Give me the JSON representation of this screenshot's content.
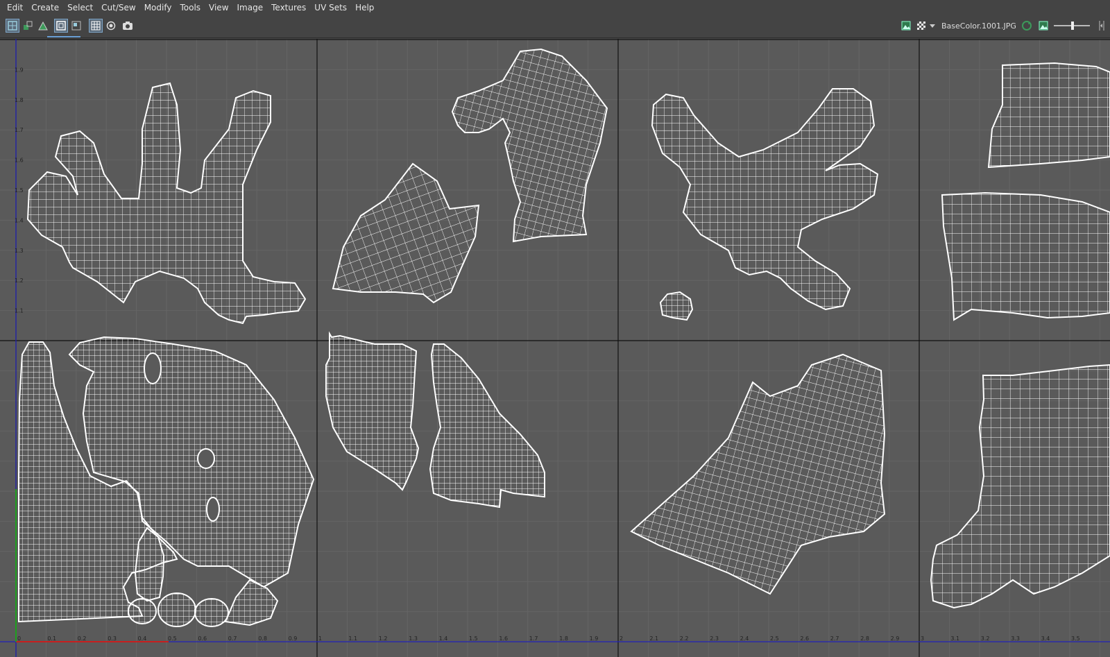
{
  "menubar": {
    "items": [
      "Edit",
      "Create",
      "Select",
      "Cut/Sew",
      "Modify",
      "Tools",
      "View",
      "Image",
      "Textures",
      "UV Sets",
      "Help"
    ]
  },
  "toolbar": {
    "left_tools": [
      {
        "name": "uv-tile-icon",
        "active": true
      },
      {
        "name": "uv-shell-icon",
        "active": false
      },
      {
        "name": "uv-shell-green-icon",
        "active": false
      },
      {
        "name": "wireframe-toggle-icon",
        "active": true
      },
      {
        "name": "shaded-uv-icon",
        "active": false
      },
      {
        "name": "grid-toggle-icon",
        "active": true
      },
      {
        "name": "isolate-icon",
        "active": false
      },
      {
        "name": "snapshot-camera-icon",
        "active": false
      }
    ],
    "right_tools": [
      {
        "name": "image-display-icon"
      },
      {
        "name": "checker-icon"
      },
      {
        "name": "dropdown-arrow-icon"
      },
      {
        "name": "refresh-texture-icon"
      },
      {
        "name": "image-toggle-icon"
      },
      {
        "name": "exposure-slider-icon"
      },
      {
        "name": "collapse-icon"
      }
    ],
    "texture_name": "BaseColor.1001.JPG"
  },
  "uv_editor": {
    "colors": {
      "background": "#5a5a5a",
      "grid": "#656565",
      "tile_border": "#111111",
      "wireframe": "#ffffff",
      "u_axis": "#c81e1e",
      "v_axis": "#1ea01e",
      "axis_extension": "#2222bb"
    },
    "u_ticks": [
      "0",
      "0.1",
      "0.2",
      "0.3",
      "0.4",
      "0.5",
      "0.6",
      "0.7",
      "0.8",
      "0.9",
      "1",
      "1.1",
      "1.2",
      "1.3",
      "1.4",
      "1.5",
      "1.6",
      "1.7",
      "1.8",
      "1.9",
      "2",
      "2.1",
      "2.2",
      "2.3",
      "2.4",
      "2.5",
      "2.6",
      "2.7",
      "2.8",
      "2.9",
      "3",
      "3.1",
      "3.2",
      "3.3",
      "3.4",
      "3.5"
    ],
    "v_ticks": [
      "1.1",
      "1.2",
      "1.3",
      "1.4",
      "1.5",
      "1.6",
      "1.7",
      "1.8",
      "1.9"
    ],
    "tiles": [
      {
        "id": "1011",
        "shells": [
          "hand-shell"
        ]
      },
      {
        "id": "1012",
        "shells": [
          "head-shell",
          "arm-shell"
        ]
      },
      {
        "id": "1013",
        "shells": [
          "hand-shell",
          "small-shell"
        ]
      },
      {
        "id": "1014",
        "shells": [
          "top-strip-shell",
          "cylinder-shell"
        ]
      },
      {
        "id": "1001",
        "shells": [
          "body-shell",
          "ear-shell",
          "small-shell",
          "small-shell",
          "small-shell"
        ]
      },
      {
        "id": "1002",
        "shells": [
          "face-shell-left",
          "face-shell-right"
        ]
      },
      {
        "id": "1003",
        "shells": [
          "torso-shell"
        ]
      },
      {
        "id": "1004",
        "shells": [
          "leg-shell"
        ]
      }
    ]
  }
}
